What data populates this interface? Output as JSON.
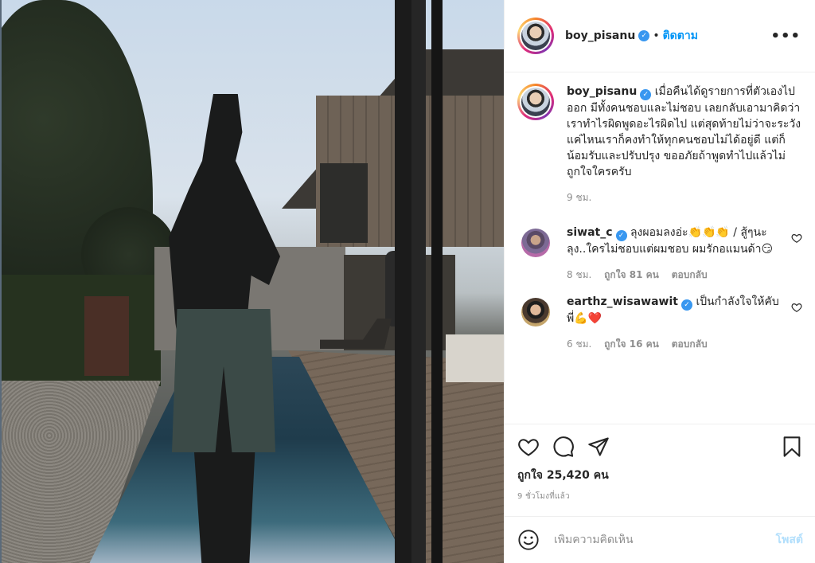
{
  "header": {
    "username": "boy_pisanu",
    "separator": "•",
    "follow_label": "ติดตาม",
    "more_label": "•••"
  },
  "caption": {
    "username": "boy_pisanu",
    "text": "เมื่อคืนได้ดูรายการที่ตัวเองไปออก มีทั้งคนชอบและไม่ชอบ เลยกลับเอามาคิดว่าเราทำไรผิดพูดอะไรผิดไป แต่สุดท้ายไม่ว่าจะระวังแค่ไหนเราก็คงทำให้ทุกคนชอบไม่ได้อยู่ดี แต่ก็น้อมรับและปรับปรุง ขออภัยถ้าพูดทำไปแล้วไม่ถูกใจใครครับ",
    "time": "9 ชม."
  },
  "comments": [
    {
      "username": "siwat_c",
      "text": "ลุงผอมลงอ่ะ👏👏👏 / สู้ๆนะลุง..ใครไม่ชอบแต่ผมชอบ ผมรักอแมนด้า😏",
      "time": "8 ชม.",
      "likes": "ถูกใจ 81 คน",
      "reply": "ตอบกลับ"
    },
    {
      "username": "earthz_wisawawit",
      "text": "เป็นกำลังใจให้คับพี่💪❤️",
      "time": "6 ชม.",
      "likes": "ถูกใจ 16 คน",
      "reply": "ตอบกลับ"
    }
  ],
  "actions": {
    "like_count": "ถูกใจ 25,420 คน",
    "time_ago": "9 ชั่วโมงที่แล้ว"
  },
  "add_comment": {
    "placeholder": "เพิ่มความคิดเห็น",
    "post_label": "โพสต์"
  },
  "colors": {
    "accent": "#0095f6",
    "verified": "#3897f0",
    "post_disabled": "#b2dffc",
    "muted": "#8e8e8e"
  },
  "icons": [
    "verified-badge-icon",
    "heart-icon",
    "comment-icon",
    "share-icon",
    "bookmark-icon",
    "emoji-icon",
    "more-options-icon"
  ]
}
